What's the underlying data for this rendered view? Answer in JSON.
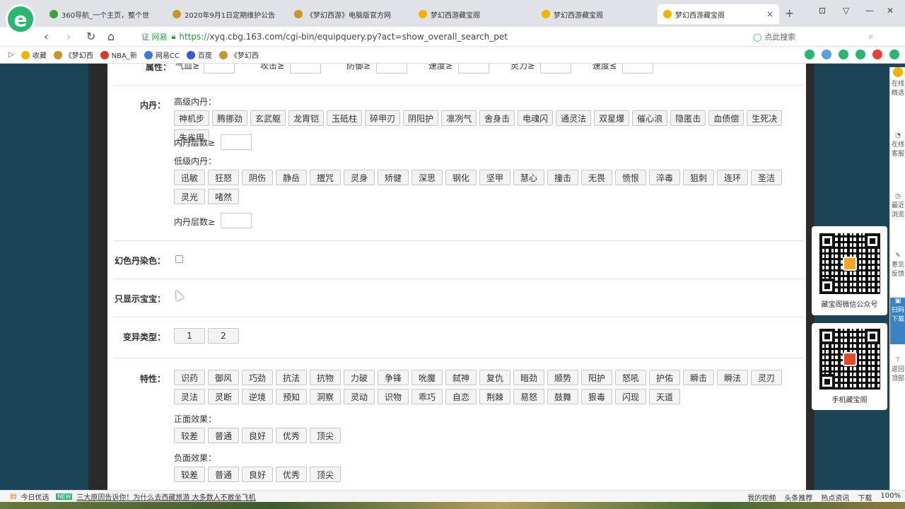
{
  "browser": {
    "tabs": [
      {
        "label": "360导航_一个主页，整个世",
        "active": false,
        "icon_color": "#3aa33a"
      },
      {
        "label": "2020年9月1日定期维护公告",
        "active": false,
        "icon_color": "#c8962c"
      },
      {
        "label": "《梦幻西游》电脑版官方网",
        "active": false,
        "icon_color": "#c8962c"
      },
      {
        "label": "梦幻西游藏宝阁",
        "active": false,
        "icon_color": "#f0b400"
      },
      {
        "label": "梦幻西游藏宝阁",
        "active": false,
        "icon_color": "#f0b400"
      },
      {
        "label": "梦幻西游藏宝阁",
        "active": true,
        "icon_color": "#f0b400"
      }
    ],
    "tab_close": "×",
    "new_tab": "+",
    "url_cert": "证 网易",
    "url_https": "https://",
    "url_rest": "xyq.cbg.163.com/cgi-bin/equipquery.py?act=show_overall_search_pet",
    "search_placeholder": "点此搜索",
    "bookmarks": [
      {
        "label": "收藏",
        "icon_color": "#f0b400"
      },
      {
        "label": "《梦幻西",
        "icon_color": "#c8962c"
      },
      {
        "label": "NBA_新",
        "icon_color": "#d9382b"
      },
      {
        "label": "网易CC",
        "icon_color": "#3a7bd5"
      },
      {
        "label": "百度",
        "icon_color": "#3a5bd5"
      },
      {
        "label": "《梦幻西",
        "icon_color": "#c8962c"
      }
    ]
  },
  "form": {
    "attr_row": [
      "气血≥",
      "攻击≥",
      "防御≥",
      "速度≥",
      "灵力≥",
      "速度≤"
    ],
    "attr_label": "属性：",
    "neidan_label": "内丹：",
    "high_neidan_label": "高级内丹：",
    "high_neidan": [
      "神机步",
      "腾挪劲",
      "玄武躯",
      "龙胄铠",
      "玉砥柱",
      "碎甲刃",
      "阴阳护",
      "凛冽气",
      "舍身击",
      "电魂闪",
      "通灵法",
      "双星爆",
      "催心浪",
      "隐匿击",
      "血债偿",
      "生死决",
      "朱雀甲"
    ],
    "neidan_layers_label_1": "内丹层数≥",
    "low_neidan_label": "低级内丹：",
    "low_neidan": [
      "迅敏",
      "狂怒",
      "阴伤",
      "静岳",
      "擅咒",
      "灵身",
      "矫健",
      "深思",
      "钢化",
      "坚甲",
      "慧心",
      "撞击",
      "无畏",
      "愤恨",
      "淬毒",
      "狙刺",
      "连环",
      "圣洁",
      "灵光",
      "啫然"
    ],
    "neidan_layers_label_2": "内丹层数≥",
    "color_label": "幻色丹染色：",
    "baby_only_label": "只显示宝宝：",
    "mutation_label": "变异类型：",
    "mutation_options": [
      "1",
      "2"
    ],
    "trait_label": "特性：",
    "traits": [
      "识药",
      "御风",
      "巧劲",
      "抗法",
      "抗物",
      "力破",
      "争锋",
      "吮魔",
      "弑神",
      "复仇",
      "暗劲",
      "顺势",
      "阳护",
      "怒吼",
      "护佑",
      "瞬击",
      "瞬法",
      "灵刃",
      "灵法",
      "灵断",
      "逆境",
      "预知",
      "洞察",
      "灵动",
      "识物",
      "乖巧",
      "自恋",
      "荆棘",
      "易怒",
      "鼓舞",
      "狠毒",
      "闪现",
      "天道"
    ],
    "positive_label": "正面效果：",
    "positive_options": [
      "较差",
      "普通",
      "良好",
      "优秀",
      "顶尖"
    ],
    "negative_label": "负面效果：",
    "negative_options": [
      "较差",
      "普通",
      "良好",
      "优秀",
      "顶尖"
    ]
  },
  "sidebar": {
    "qr1_caption": "藏宝阁微信公众号",
    "qr2_caption": "手机藏宝阁",
    "tools": [
      "在线精选",
      "在线客服",
      "最近浏览",
      "意见反馈",
      "扫码下载",
      "返回顶部"
    ]
  },
  "statusbar": {
    "today": "今日优选",
    "new_badge": "NEW",
    "news": "三大原因告诉你！为什么去西藏旅游 大多数人不敢坐飞机",
    "items": [
      "我的视频",
      "头条推荐",
      "热点资讯",
      "下载",
      "100%"
    ]
  }
}
